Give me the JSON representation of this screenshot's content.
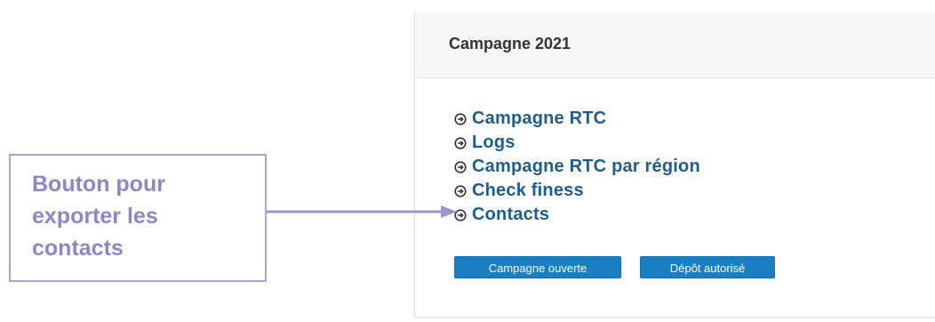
{
  "panel": {
    "title": "Campagne 2021",
    "links": [
      {
        "label": "Campagne RTC",
        "icon": "circle-arrow-right-icon"
      },
      {
        "label": "Logs",
        "icon": "circle-arrow-right-icon"
      },
      {
        "label": "Campagne RTC par région",
        "icon": "circle-arrow-right-icon"
      },
      {
        "label": "Check finess",
        "icon": "circle-arrow-right-icon"
      },
      {
        "label": "Contacts",
        "icon": "circle-arrow-right-icon"
      }
    ],
    "buttons": {
      "campagne_ouverte": "Campagne ouverte",
      "depot_autorise": "Dépôt autorisé"
    }
  },
  "annotation": {
    "text": "Bouton pour\nexporter les\ncontacts",
    "color": "#8d87c4"
  },
  "colors": {
    "link": "#1f5d8c",
    "button": "#1a7fc2",
    "annotation_border": "#a7a3d3"
  }
}
